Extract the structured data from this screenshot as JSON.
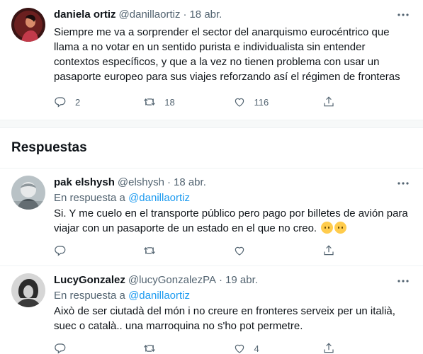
{
  "main_tweet": {
    "author": "daniela ortiz",
    "handle": "@danillaortiz",
    "separator": "·",
    "date": "18 abr.",
    "text": "Siempre me va a sorprender el sector del anarquismo eurocéntrico que llama a no votar en un sentido purista e individualista sin entender contextos específicos, y que a la vez no tienen problema con usar un pasaporte europeo para sus viajes reforzando así el régimen de fronteras",
    "replies": "2",
    "retweets": "18",
    "likes": "116"
  },
  "section_title": "Respuestas",
  "replies": [
    {
      "author": "pak elshysh",
      "handle": "@elshysh",
      "separator": "·",
      "date": "18 abr.",
      "reply_prefix": "En respuesta a",
      "reply_to": "@danillaortiz",
      "text": "Si. Y me cuelo en el transporte público pero pago por billetes de avión para viajar con un pasaporte de un estado en el que no creo.",
      "emoji": [
        "neutral-face",
        "neutral-face"
      ],
      "replies": "",
      "retweets": "",
      "likes": ""
    },
    {
      "author": "LucyGonzalez",
      "handle": "@lucyGonzalezPA",
      "separator": "·",
      "date": "19 abr.",
      "reply_prefix": "En respuesta a",
      "reply_to": "@danillaortiz",
      "text": "Això de ser ciutadà del món i no creure en fronteres serveix per un italià, suec o català.. una marroquina no s'ho pot permetre.",
      "replies": "",
      "retweets": "",
      "likes": "4"
    }
  ],
  "icons": {
    "more": "more-dots-icon",
    "reply": "reply-icon",
    "retweet": "retweet-icon",
    "like": "heart-icon",
    "share": "share-icon"
  },
  "colors": {
    "text": "#0f1419",
    "secondary": "#536471",
    "link": "#1d9bf0",
    "divider": "#eff3f4"
  }
}
